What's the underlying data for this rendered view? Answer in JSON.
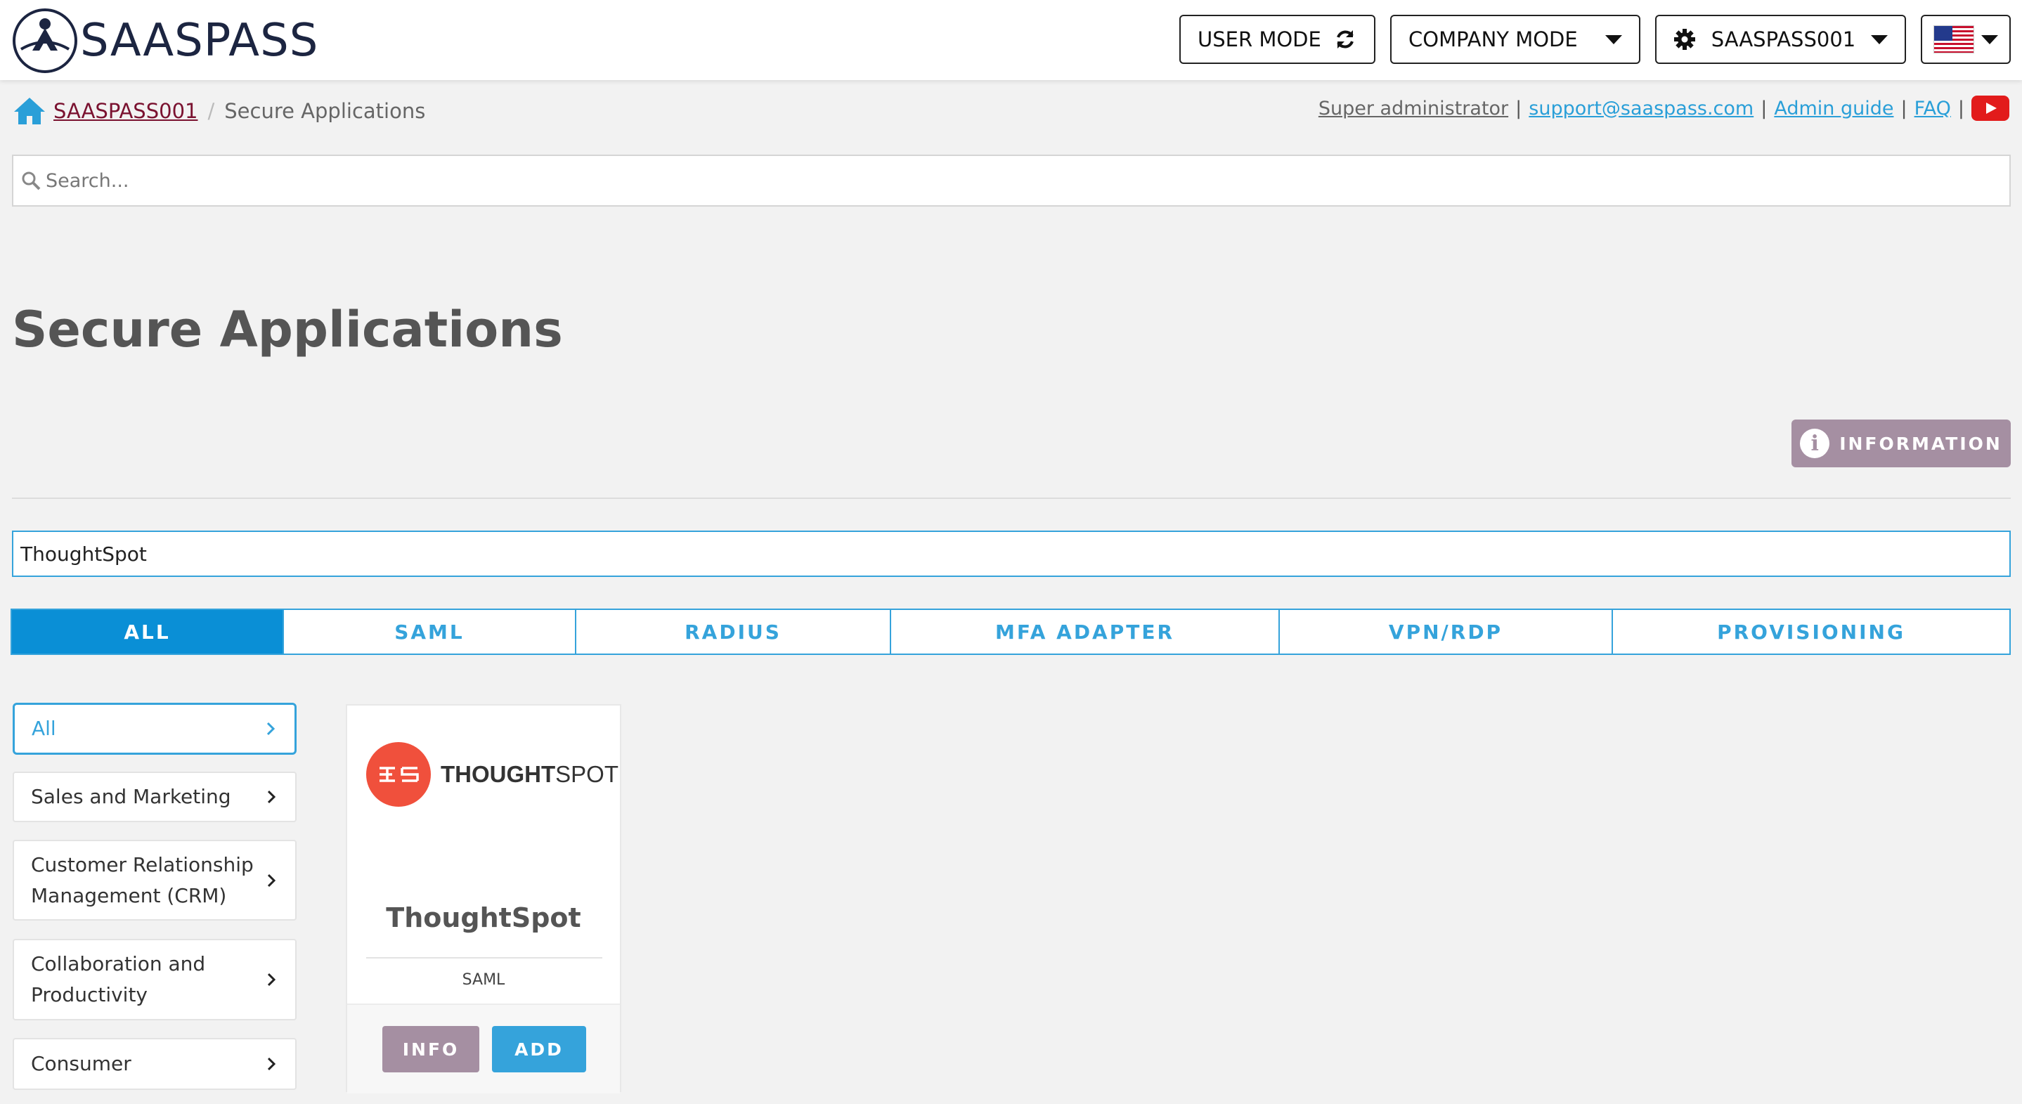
{
  "header": {
    "brand": "SAASPASS",
    "user_mode_label": "USER MODE",
    "company_mode_label": "COMPANY MODE",
    "org_label": "SAASPASS001",
    "language_flag": "us-flag-icon"
  },
  "breadcrumb": {
    "home": "SAASPASS001",
    "current": "Secure Applications"
  },
  "top_links": {
    "role": "Super administrator",
    "support_email": "support@saaspass.com",
    "admin_guide": "Admin guide",
    "faq": "FAQ"
  },
  "search": {
    "placeholder": "Search..."
  },
  "page": {
    "title": "Secure Applications",
    "information_label": "INFORMATION"
  },
  "filter": {
    "value": "ThoughtSpot"
  },
  "tabs": [
    {
      "label": "ALL",
      "active": true
    },
    {
      "label": "SAML",
      "active": false
    },
    {
      "label": "RADIUS",
      "active": false
    },
    {
      "label": "MFA ADAPTER",
      "active": false
    },
    {
      "label": "VPN/RDP",
      "active": false
    },
    {
      "label": "PROVISIONING",
      "active": false
    }
  ],
  "categories": [
    {
      "label": "All",
      "active": true
    },
    {
      "label": "Sales and Marketing"
    },
    {
      "label": "Customer Relationship Management (CRM)"
    },
    {
      "label": "Collaboration and Productivity"
    },
    {
      "label": "Consumer"
    }
  ],
  "app_card": {
    "logo_wordmark_bold": "THOUGHT",
    "logo_wordmark_light": "SPOT",
    "name": "ThoughtSpot",
    "type": "SAML",
    "info_label": "INFO",
    "add_label": "ADD"
  },
  "colors": {
    "accent": "#35a3db",
    "active_tab": "#0a8fd6",
    "mauve": "#a58fa2",
    "brand_link": "#7a1230",
    "thoughtspot_red": "#f0503c"
  }
}
